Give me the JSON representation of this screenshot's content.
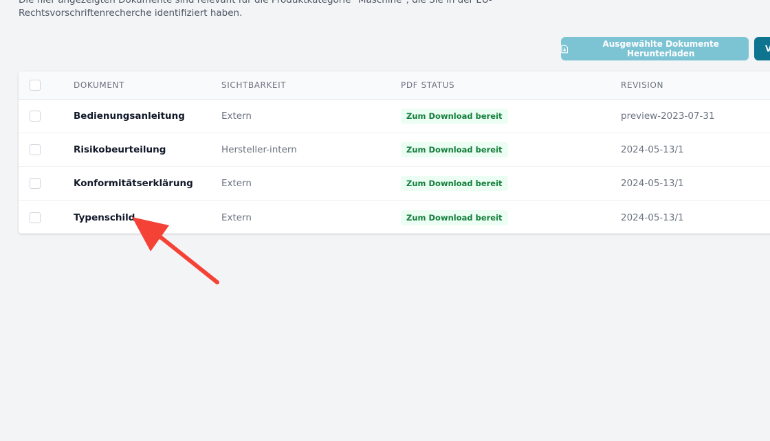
{
  "intro": {
    "line1": "Die hier angezeigten Dokumente sind relevant für die Produktkategorie \"Maschine\", die Sie in der EU-",
    "line2": "Rechtsvorschriftenrecherche identifiziert haben."
  },
  "toolbar": {
    "download_label": "Ausgewählte Dokumente Herunterladen",
    "download_icon": "download-file-icon",
    "second_label": "V"
  },
  "table": {
    "columns": [
      "DOKUMENT",
      "SICHTBARKEIT",
      "PDF STATUS",
      "REVISION"
    ],
    "rows": [
      {
        "document": "Bedienungsanleitung",
        "visibility": "Extern",
        "pdf_status": "Zum Download bereit",
        "revision": "preview-2023-07-31"
      },
      {
        "document": "Risikobeurteilung",
        "visibility": "Hersteller-intern",
        "pdf_status": "Zum Download bereit",
        "revision": "2024-05-13/1"
      },
      {
        "document": "Konformitätserklärung",
        "visibility": "Extern",
        "pdf_status": "Zum Download bereit",
        "revision": "2024-05-13/1"
      },
      {
        "document": "Typenschild",
        "visibility": "Extern",
        "pdf_status": "Zum Download bereit",
        "revision": "2024-05-13/1"
      }
    ]
  },
  "colors": {
    "background": "#f3f4f6",
    "download_button": "#7cc4d4",
    "primary_button": "#0e7490",
    "badge_bg": "#ecfdf3",
    "badge_text": "#15803d",
    "annotation_arrow": "#f44336"
  }
}
